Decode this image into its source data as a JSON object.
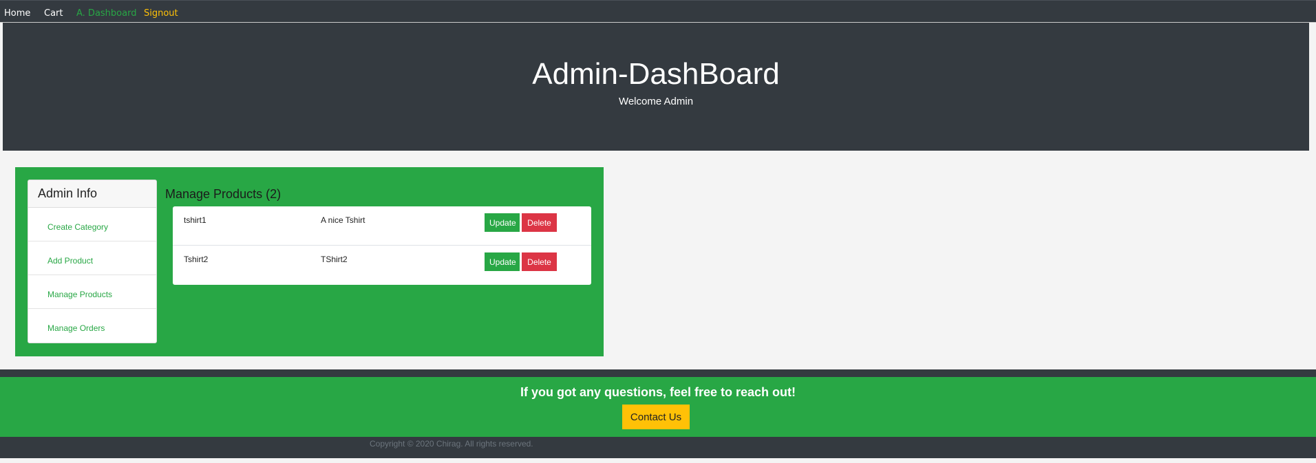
{
  "nav": {
    "home": "Home",
    "cart": "Cart",
    "dashboard": "A. Dashboard",
    "signout": "Signout"
  },
  "hero": {
    "title": "Admin-DashBoard",
    "subtitle": "Welcome Admin"
  },
  "admin_info": {
    "header": "Admin Info",
    "links": [
      {
        "label": "Create Category"
      },
      {
        "label": "Add Product"
      },
      {
        "label": "Manage Products"
      },
      {
        "label": "Manage Orders"
      }
    ]
  },
  "manage_products": {
    "title": "Manage Products (2)",
    "rows": [
      {
        "name": "tshirt1",
        "description": "A nice Tshirt",
        "update_label": "Update",
        "delete_label": "Delete"
      },
      {
        "name": "Tshirt2",
        "description": "TShirt2",
        "update_label": "Update",
        "delete_label": "Delete"
      }
    ]
  },
  "footer": {
    "question": "If you got any questions, feel free to reach out!",
    "contact_label": "Contact Us",
    "copyright": "Copyright © 2020 Chirag. All rights reserved."
  },
  "colors": {
    "dark": "#343a40",
    "green": "#28a745",
    "yellow": "#ffc107",
    "red": "#dc3545"
  }
}
